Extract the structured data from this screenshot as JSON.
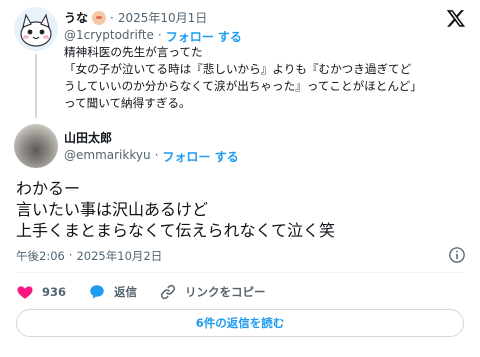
{
  "colors": {
    "accent": "#1d9bf0",
    "heart": "#f91880",
    "text": "#0f1419",
    "muted": "#536471"
  },
  "quoted": {
    "name": "うな",
    "date": "2025年10月1日",
    "handle": "@1cryptodrifte",
    "follow": "フォロー する",
    "lines": [
      "精神科医の先生が言ってた",
      "「女の子が泣いてる時は『悲しいから』よりも『むかつき過ぎてど",
      "うしていいのか分からなくて涙が出ちゃった』ってことがほとんど」",
      "って聞いて納得すぎる。"
    ]
  },
  "tweet": {
    "name": "山田太郎",
    "handle": "@emmarikkyu",
    "follow": "フォロー する",
    "lines": [
      "わかるー",
      "言いたい事は沢山あるけど",
      "上手くまとまらなくて伝えられなくて泣く笑"
    ],
    "time": "午後2:06",
    "date": "2025年10月2日"
  },
  "actions": {
    "like_count": "936",
    "reply_label": "返信",
    "copy_label": "リンクをコピー"
  },
  "read_replies": "6件の返信を読む",
  "icons": [
    "x-logo-icon",
    "info-icon",
    "heart-icon",
    "reply-icon",
    "link-icon"
  ]
}
